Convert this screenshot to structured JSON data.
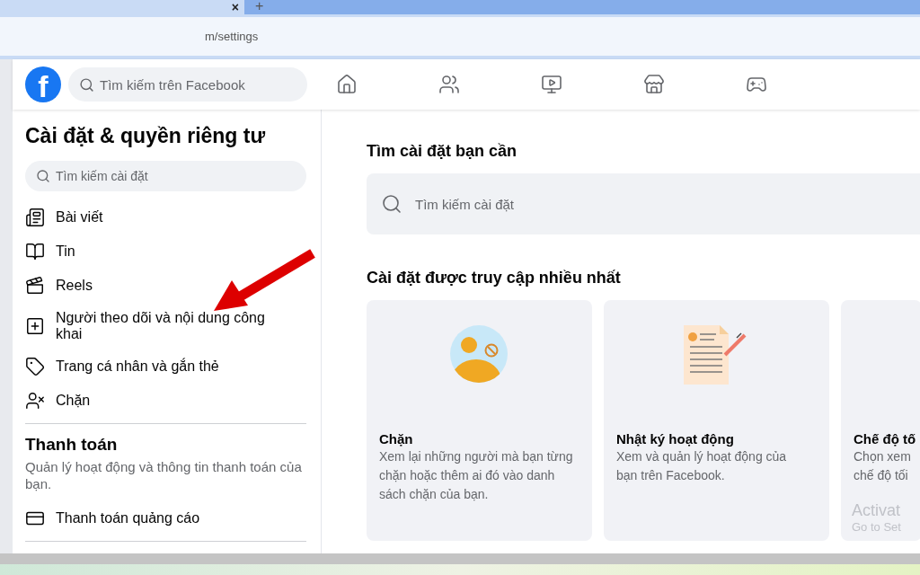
{
  "browser": {
    "tab_close": "×",
    "new_tab": "+",
    "address": "m/settings"
  },
  "header": {
    "logo": "f",
    "search_placeholder": "Tìm kiếm trên Facebook",
    "nav": [
      {
        "kind": "home"
      },
      {
        "kind": "friends"
      },
      {
        "kind": "video"
      },
      {
        "kind": "marketplace"
      },
      {
        "kind": "gaming"
      }
    ]
  },
  "sidebar": {
    "title": "Cài đặt & quyền riêng tư",
    "search_placeholder": "Tìm kiếm cài đặt",
    "items": [
      {
        "kind": "posts",
        "label": "Bài viết"
      },
      {
        "kind": "stories",
        "label": "Tin"
      },
      {
        "kind": "reels",
        "label": "Reels"
      },
      {
        "kind": "followers",
        "label": "Người theo dõi và nội dung công khai"
      },
      {
        "kind": "tag",
        "label": "Trang cá nhân và gắn thẻ"
      },
      {
        "kind": "block",
        "label": "Chặn"
      }
    ],
    "sections": [
      {
        "title": "Thanh toán",
        "description": "Quản lý hoạt động và thông tin thanh toán của bạn.",
        "items": [
          {
            "kind": "card",
            "label": "Thanh toán quảng cáo"
          }
        ]
      }
    ]
  },
  "main": {
    "search_heading": "Tìm cài đặt bạn cần",
    "search_placeholder": "Tìm kiếm cài đặt",
    "most_visited_heading": "Cài đặt được truy cập nhiều nhất",
    "cards": [
      {
        "kind": "block",
        "title": "Chặn",
        "lines": [
          "Xem lại những người mà bạn từng",
          "chặn hoặc thêm ai đó vào danh",
          "sách chặn của bạn."
        ]
      },
      {
        "kind": "activity",
        "title": "Nhật ký hoạt động",
        "lines": [
          "Xem và quản lý hoạt động của",
          "bạn trên Facebook."
        ]
      },
      {
        "kind": "dark",
        "title": "Chế độ tố",
        "lines": [
          "Chọn xem",
          "chế độ tối"
        ]
      }
    ]
  },
  "windows_notice": {
    "title": "Activat",
    "subtitle": "Go to Set"
  }
}
